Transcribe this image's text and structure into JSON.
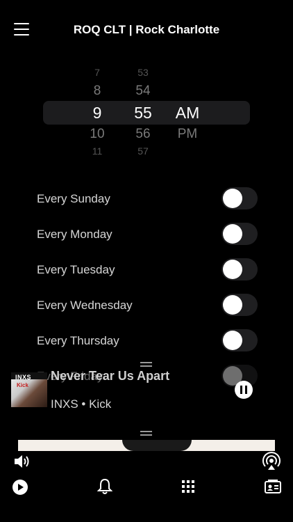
{
  "header": {
    "title": "ROQ CLT | Rock Charlotte"
  },
  "time_picker": {
    "hours": [
      "7",
      "8",
      "9",
      "10",
      "11"
    ],
    "minutes": [
      "53",
      "54",
      "55",
      "56",
      "57"
    ],
    "periods": [
      "AM",
      "PM"
    ],
    "selected": {
      "hour": "9",
      "minute": "55",
      "period": "AM"
    }
  },
  "alarms": [
    {
      "label": "Every Sunday",
      "enabled": false
    },
    {
      "label": "Every Monday",
      "enabled": false
    },
    {
      "label": "Every Tuesday",
      "enabled": false
    },
    {
      "label": "Every Wednesday",
      "enabled": false
    },
    {
      "label": "Every Thursday",
      "enabled": false
    },
    {
      "label": "Every Friday",
      "enabled": false
    }
  ],
  "now_playing": {
    "track": "Never Tear Us Apart",
    "artist_line": "INXS • Kick",
    "cover_text": "INXS",
    "cover_subtext": "Kick",
    "state": "playing"
  },
  "toolbar": {
    "volume": "volume-icon",
    "airplay": "airplay-icon",
    "play": "play-icon",
    "alarm": "bell-icon",
    "grid": "grid-icon",
    "contact": "contact-card-icon"
  }
}
